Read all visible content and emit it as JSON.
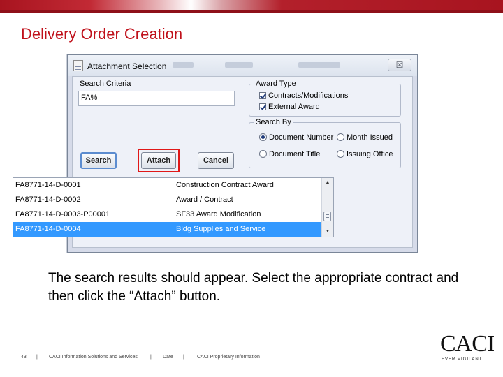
{
  "slide": {
    "title": "Delivery Order Creation",
    "instruction": "The search results should appear.  Select the appropriate contract and then click the “Attach” button."
  },
  "dialog": {
    "title": "Attachment Selection",
    "close_symbol": "☒",
    "search_criteria_label": "Search Criteria",
    "search_criteria_value": "FA%",
    "award_type": {
      "title": "Award Type",
      "options": [
        {
          "label": "Contracts/Modifications",
          "checked": true
        },
        {
          "label": "External Award",
          "checked": true
        }
      ]
    },
    "search_by": {
      "title": "Search By",
      "options": [
        {
          "label": "Document Number",
          "selected": true
        },
        {
          "label": "Month Issued",
          "selected": false
        },
        {
          "label": "Document Title",
          "selected": false
        },
        {
          "label": "Issuing Office",
          "selected": false
        }
      ]
    },
    "buttons": {
      "search": "Search",
      "attach": "Attach",
      "cancel": "Cancel"
    },
    "results": [
      {
        "number": "FA8771-14-D-0001",
        "title": "Construction Contract Award",
        "selected": false
      },
      {
        "number": "FA8771-14-D-0002",
        "title": "Award / Contract",
        "selected": false
      },
      {
        "number": "FA8771-14-D-0003-P00001",
        "title": "SF33 Award Modification",
        "selected": false
      },
      {
        "number": "FA8771-14-D-0004",
        "title": "Bldg Supplies and Service",
        "selected": true
      }
    ]
  },
  "footer": {
    "page_number": "43",
    "separator": "|",
    "company": "CACI Information Solutions and Services",
    "date": "Date",
    "proprietary": "CACI Proprietary Information"
  },
  "logo": {
    "name": "CACI",
    "tagline": "EVER VIGILANT"
  },
  "colors": {
    "title_red": "#c0111b",
    "selection_blue": "#3399ff",
    "highlight_red": "#e01818"
  }
}
